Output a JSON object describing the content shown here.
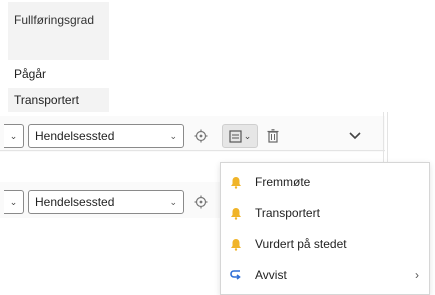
{
  "table": {
    "column_header": "Fullføringsgrad",
    "rows": [
      "Pågår",
      "Transportert"
    ]
  },
  "editor_rows": [
    {
      "location_select": "Hendelsessted"
    },
    {
      "location_select": "Hendelsessted"
    }
  ],
  "menu": {
    "items": [
      {
        "label": "Fremmøte",
        "icon": "bell-icon"
      },
      {
        "label": "Transportert",
        "icon": "bell-icon"
      },
      {
        "label": "Vurdert på stedet",
        "icon": "bell-icon"
      },
      {
        "label": "Avvist",
        "icon": "return-arrow-icon",
        "has_submenu": true
      }
    ]
  },
  "colors": {
    "bell": "#f0b429",
    "return_arrow": "#2f6fd6",
    "header_bg": "#f3f3f3",
    "split_button_bg": "#e6e6e6"
  }
}
